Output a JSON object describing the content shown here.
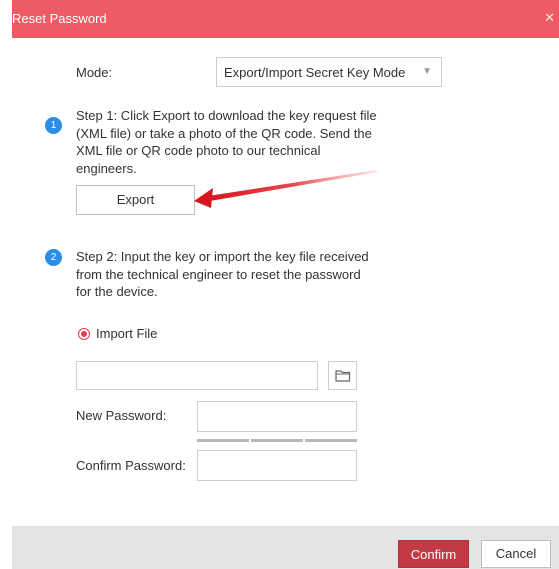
{
  "dialog": {
    "title": "Reset Password",
    "close_icon": "close-icon"
  },
  "mode": {
    "label": "Mode:",
    "value": "Export/Import Secret Key Mode"
  },
  "step1": {
    "badge": "1",
    "lines": [
      "Step 1: Click Export to download the key request file",
      "(XML file) or take a photo of the QR code. Send the",
      "XML file or QR code photo to our technical",
      "engineers."
    ],
    "export_label": "Export"
  },
  "step2": {
    "badge": "2",
    "lines": [
      "Step 2: Input the key or import the key file received",
      "from the technical engineer to reset the password",
      "for the device."
    ]
  },
  "import": {
    "radio_label": "Import File",
    "file_value": "",
    "folder_icon": "folder-icon"
  },
  "new_password": {
    "label": "New Password:",
    "value": ""
  },
  "confirm_password": {
    "label": "Confirm Password:",
    "value": ""
  },
  "footer": {
    "confirm_label": "Confirm",
    "cancel_label": "Cancel"
  },
  "colors": {
    "title_bar": "#ef5b65",
    "primary_button": "#c43a44",
    "step_badge": "#2a8de8",
    "annotation_arrow": "#e0252f"
  }
}
